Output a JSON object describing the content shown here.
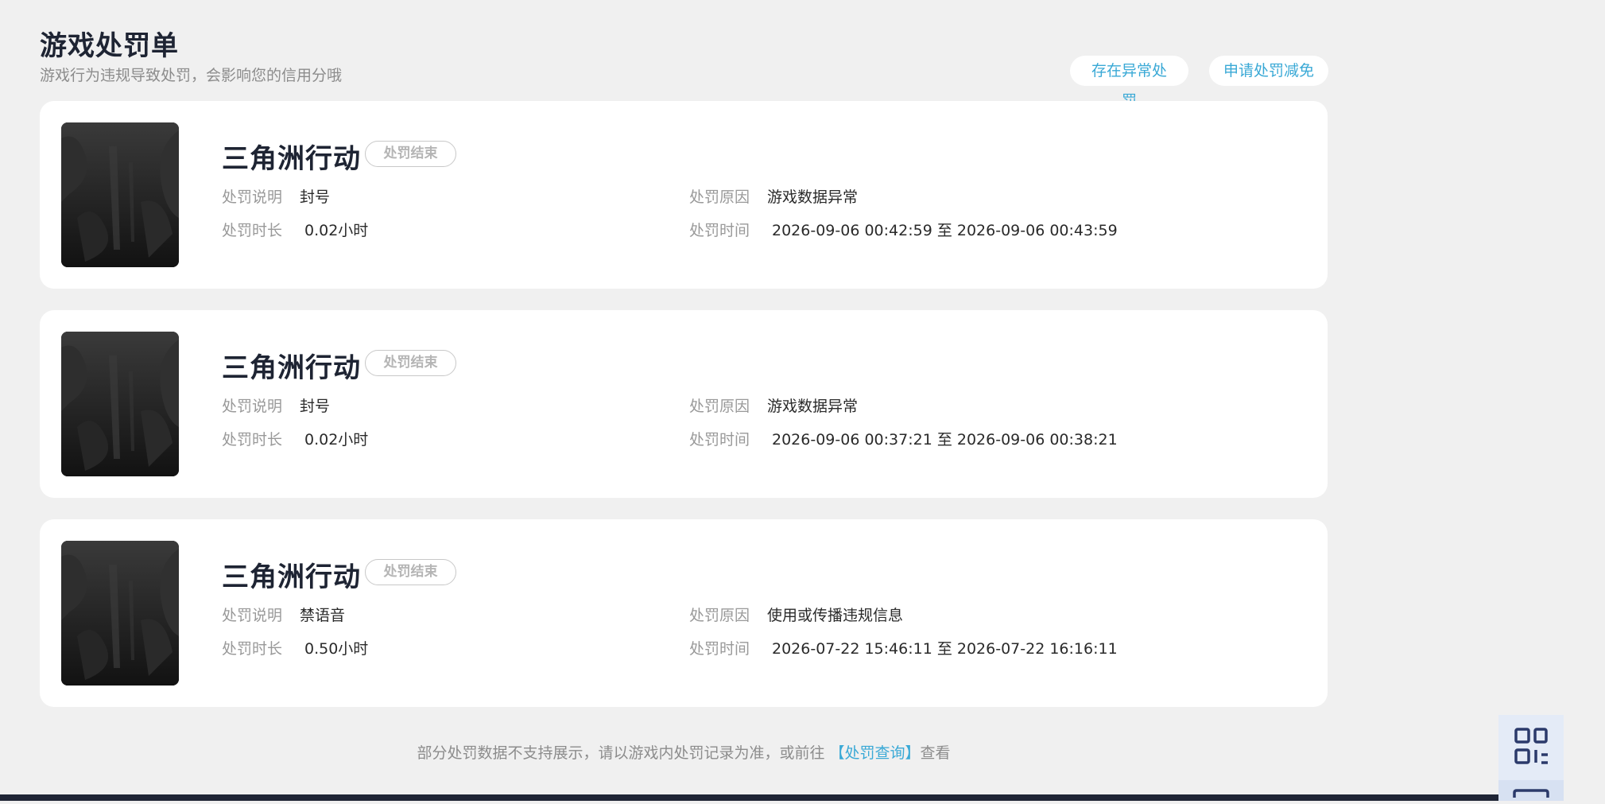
{
  "header": {
    "title": "游戏处罚单",
    "subtitle": "游戏行为违规导致处罚，会影响您的信用分哦",
    "btn_abnormal": "存在异常处罚",
    "btn_appeal": "申请处罚减免"
  },
  "labels": {
    "desc": "处罚说明",
    "duration": "处罚时长",
    "reason": "处罚原因",
    "time": "处罚时间"
  },
  "records": [
    {
      "game": "三角洲行动",
      "status": "处罚结束",
      "desc": "封号",
      "duration": "0.02小时",
      "reason": "游戏数据异常",
      "time": "2026-09-06 00:42:59 至 2026-09-06 00:43:59"
    },
    {
      "game": "三角洲行动",
      "status": "处罚结束",
      "desc": "封号",
      "duration": "0.02小时",
      "reason": "游戏数据异常",
      "time": "2026-09-06 00:37:21 至 2026-09-06 00:38:21"
    },
    {
      "game": "三角洲行动",
      "status": "处罚结束",
      "desc": "禁语音",
      "duration": "0.50小时",
      "reason": "使用或传播违规信息",
      "time": "2026-07-22 15:46:11 至 2026-07-22 16:16:11"
    }
  ],
  "footer": {
    "text_before": "部分处罚数据不支持展示，请以游戏内处罚记录为准，或前往 ",
    "link": "【处罚查询】",
    "text_after": "查看"
  },
  "icons": {
    "qr": "qr-code-icon",
    "message": "message-icon"
  },
  "colors": {
    "accent": "#3aa9d6",
    "title": "#1e2433",
    "background": "#f0f0f0"
  }
}
